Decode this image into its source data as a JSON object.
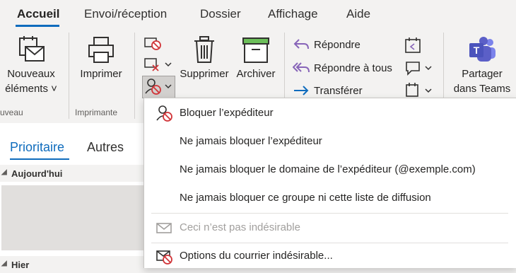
{
  "tabs": [
    "Accueil",
    "Envoi/réception",
    "Dossier",
    "Affichage",
    "Aide"
  ],
  "ribbon": {
    "new_items_line1": "Nouveaux",
    "new_items_line2": "éléments ˅",
    "group_new_partial": "uveau",
    "print": "Imprimer",
    "group_print": "Imprimante",
    "delete": "Supprimer",
    "archive": "Archiver",
    "reply": "Répondre",
    "reply_all": "Répondre à tous",
    "forward": "Transférer",
    "share_line1": "Partager",
    "share_line2": "dans Teams"
  },
  "left": {
    "pivot_focused": "Prioritaire",
    "pivot_other": "Autres",
    "group_today": "Aujourd'hui",
    "group_yesterday": "Hier"
  },
  "menu": {
    "items": [
      {
        "label": "Bloquer l’expéditeur",
        "icon": "block-sender-icon",
        "disabled": false
      },
      {
        "label": "Ne jamais bloquer l’expéditeur",
        "icon": "",
        "disabled": false
      },
      {
        "label": "Ne jamais bloquer le domaine de l’expéditeur (@exemple.com)",
        "icon": "",
        "disabled": false
      },
      {
        "label": "Ne jamais bloquer ce groupe ni cette liste de diffusion",
        "icon": "",
        "disabled": false
      },
      {
        "label": "Ceci n’est pas indésirable",
        "icon": "envelope-icon",
        "disabled": true
      },
      {
        "label": "Options du courrier indésirable...",
        "icon": "junk-options-icon",
        "disabled": false
      }
    ]
  },
  "colors": {
    "accent": "#0f6cbd",
    "red": "#d13438",
    "purple": "#8764b8",
    "teams": "#5b5fc7"
  }
}
